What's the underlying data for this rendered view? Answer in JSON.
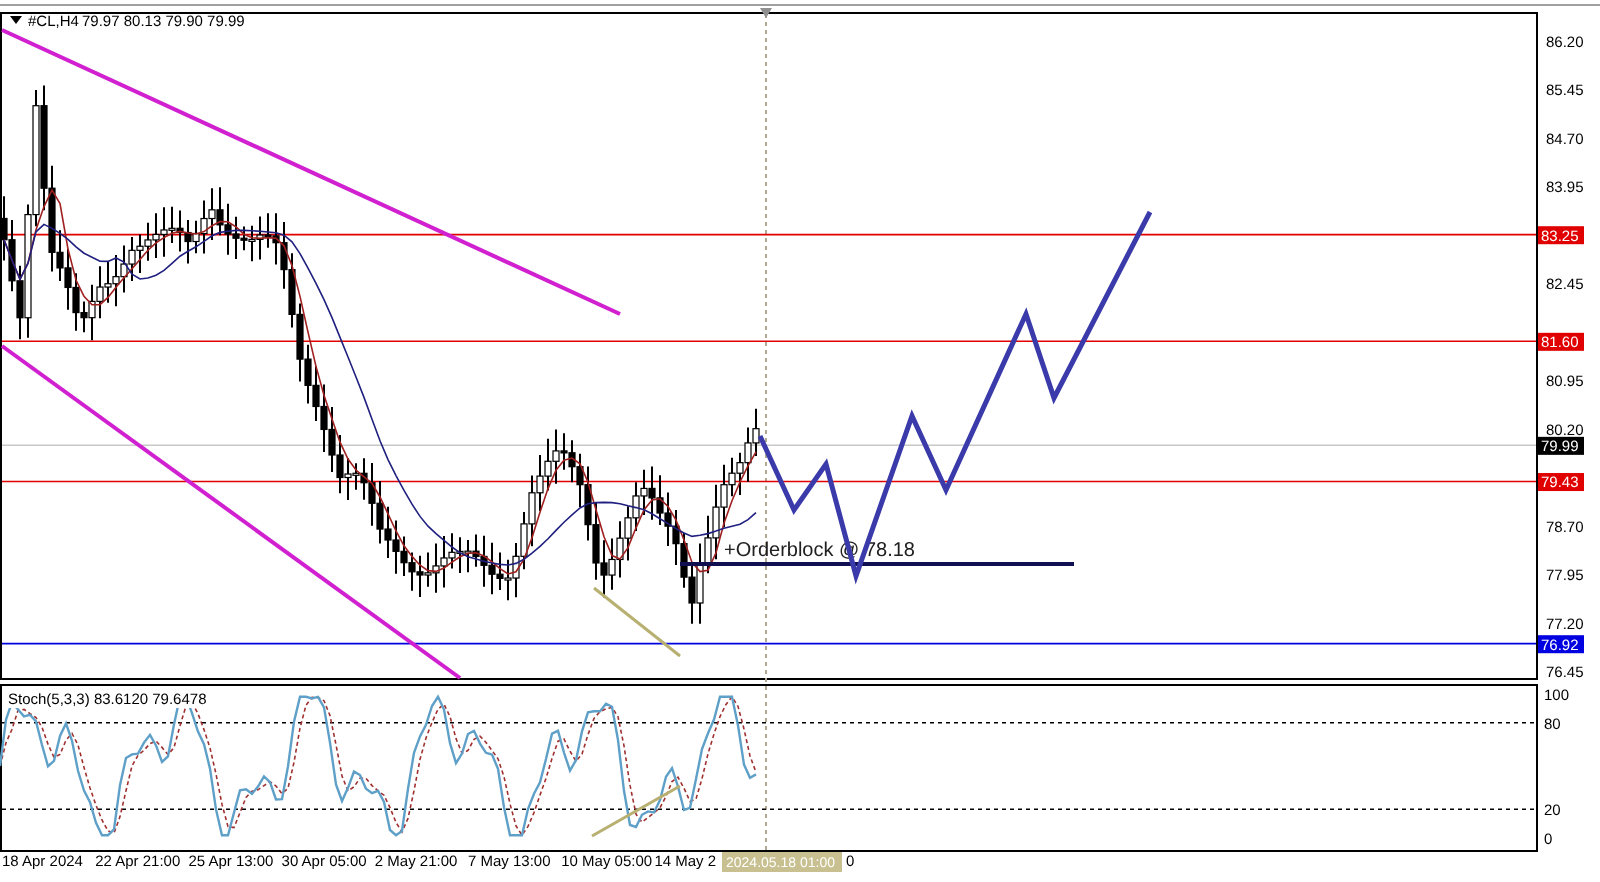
{
  "header": {
    "symbol": "#CL,H4",
    "ohlc": "79.97 80.13 79.90 79.99"
  },
  "price_axis": {
    "ticks": [
      "86.20",
      "85.45",
      "84.70",
      "83.95",
      "82.45",
      "80.95",
      "80.20",
      "78.70",
      "77.95",
      "77.20",
      "76.45"
    ]
  },
  "price_tags": [
    {
      "label": "83.25",
      "color": "#e00000"
    },
    {
      "label": "81.60",
      "color": "#e00000"
    },
    {
      "label": "79.99",
      "color": "#000000"
    },
    {
      "label": "79.43",
      "color": "#e00000"
    },
    {
      "label": "76.92",
      "color": "#0000e0"
    }
  ],
  "annotation": "+Orderblock @ 78.18",
  "stoch": {
    "label": "Stoch(5,3,3) 83.6120 79.6478",
    "levels": [
      "100",
      "80",
      "20",
      "0"
    ]
  },
  "time_axis": {
    "labels": [
      "18 Apr 2024",
      "22 Apr 21:00",
      "25 Apr 13:00",
      "30 Apr 05:00",
      "2 May 21:00",
      "7 May 13:00",
      "10 May 05:00",
      "14 May 2"
    ],
    "cursor_label": "2024.05.18 01:00",
    "trailing": "0"
  }
}
